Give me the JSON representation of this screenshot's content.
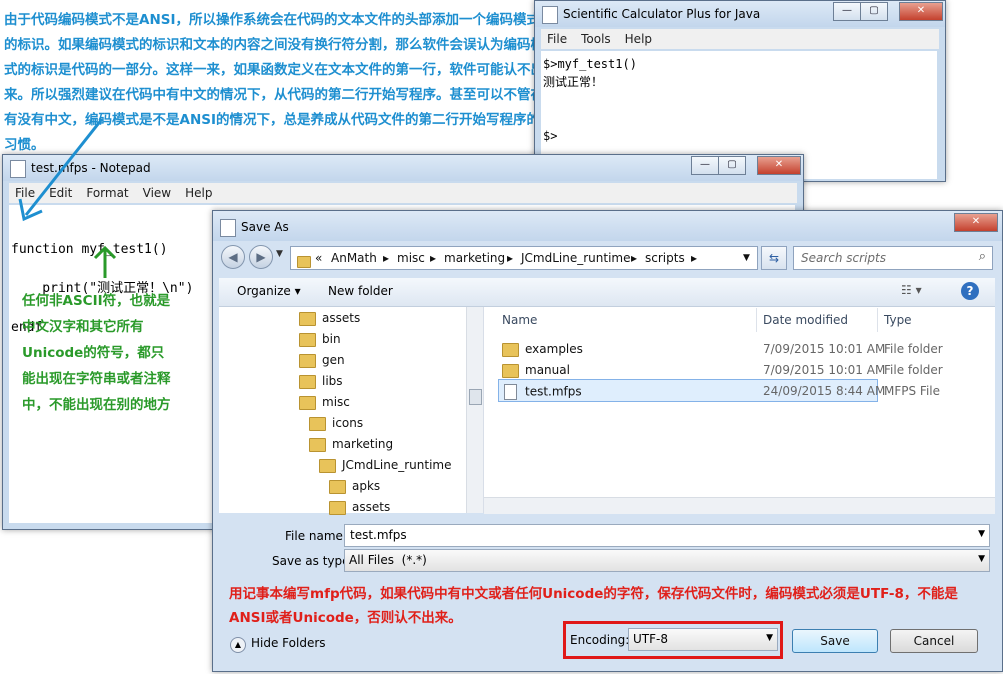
{
  "annotations": {
    "blue_text": "由于代码编码模式不是ANSI，所以操作系统会在代码的文本文件的头部添加一个编码模式的标识。如果编码模式的标识和文本的内容之间没有换行符分割，那么软件会误认为编码模式的标识是代码的一部分。这样一来，如果函数定义在文本文件的第一行，软件可能认不出来。所以强烈建议在代码中有中文的情况下，从代码的第二行开始写程序。甚至可以不管在有没有中文，编码模式是不是ANSI的情况下，总是养成从代码文件的第二行开始写程序的习惯。",
    "green_text": "任何非ASCII符，也就是中文汉字和其它所有Unicode的符号，都只能出现在字符串或者注释中，不能出现在别的地方",
    "red_text": "用记事本编写mfp代码，如果代码中有中文或者任何Unicode的字符，保存代码文件时，编码模式必须是UTF-8，不能是ANSI或者Unicode，否则认不出来。"
  },
  "calculator": {
    "title": "Scientific Calculator Plus for Java",
    "menu": [
      "File",
      "Tools",
      "Help"
    ],
    "lines": [
      "$>myf_test1()",
      "测试正常！",
      "",
      "",
      "$>"
    ]
  },
  "notepad": {
    "title": "test.mfps - Notepad",
    "menu": [
      "File",
      "Edit",
      "Format",
      "View",
      "Help"
    ],
    "code": [
      "function myf_test1()",
      "    print(\"测试正常！\\n\")",
      "endf"
    ]
  },
  "save_as": {
    "title": "Save As",
    "breadcrumb": [
      "«",
      "AnMath",
      "misc",
      "marketing",
      "JCmdLine_runtime",
      "scripts"
    ],
    "search_placeholder": "Search scripts",
    "toolbar": {
      "organize": "Organize",
      "new_folder": "New folder"
    },
    "tree": [
      "assets",
      "bin",
      "gen",
      "libs",
      "misc",
      "icons",
      "marketing",
      "JCmdLine_runtime",
      "apks",
      "assets"
    ],
    "columns": {
      "name": "Name",
      "date": "Date modified",
      "type": "Type"
    },
    "files": [
      {
        "name": "examples",
        "date": "7/09/2015 10:01 AM",
        "type": "File folder"
      },
      {
        "name": "manual",
        "date": "7/09/2015 10:01 AM",
        "type": "File folder"
      },
      {
        "name": "test.mfps",
        "date": "24/09/2015 8:44 AM",
        "type": "MFPS File"
      }
    ],
    "file_name_label": "File name:",
    "file_name_value": "test.mfps",
    "save_type_label": "Save as type:",
    "save_type_value": "All Files  (*.*)",
    "hide_folders": "Hide Folders",
    "encoding_label": "Encoding:",
    "encoding_value": "UTF-8",
    "save_button": "Save",
    "cancel_button": "Cancel"
  },
  "colors": {
    "annotation_blue": "#1e8fd0",
    "annotation_green": "#2a9a2a",
    "annotation_red": "#e0201a",
    "highlight_box": "#e01818"
  }
}
